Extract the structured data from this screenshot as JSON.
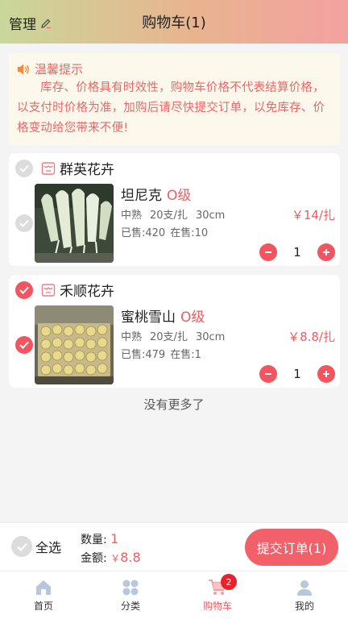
{
  "header": {
    "manage_label": "管理",
    "title": "购物车(1)"
  },
  "notice": {
    "title": "温馨提示",
    "text": "库存、价格具有时效性，购物车价格不代表结算价格，以支付时价格为准，加购后请尽快提交订单，以免库存、价格变动给您带来不便!"
  },
  "cart": [
    {
      "shop": "群英花卉",
      "shop_checked": false,
      "item": {
        "name": "坦尼克",
        "grade": "O级",
        "maturity": "中熟",
        "pack": "20支/扎",
        "length": "30cm",
        "sold": "已售:420",
        "on_sale": "在售:10",
        "price": "￥14/扎",
        "qty": "1",
        "checked": false
      }
    },
    {
      "shop": "禾顺花卉",
      "shop_checked": true,
      "item": {
        "name": "蜜桃雪山",
        "grade": "O级",
        "maturity": "中熟",
        "pack": "20支/扎",
        "length": "30cm",
        "sold": "已售:479",
        "on_sale": "在售:1",
        "price": "￥8.8/扎",
        "qty": "1",
        "checked": true
      }
    }
  ],
  "no_more": "没有更多了",
  "footer": {
    "select_all": "全选",
    "qty_label": "数量:",
    "qty_value": "1",
    "amount_label": "金额:",
    "amount_currency": "￥",
    "amount_value": "8.8",
    "submit_label": "提交订单(1)"
  },
  "tabbar": {
    "items": [
      {
        "label": "首页",
        "icon": "home-icon"
      },
      {
        "label": "分类",
        "icon": "category-icon"
      },
      {
        "label": "购物车",
        "icon": "cart-icon",
        "badge": "2",
        "active": true
      },
      {
        "label": "我的",
        "icon": "profile-icon"
      }
    ]
  },
  "colors": {
    "accent": "#f2555f",
    "price": "#ec5d62",
    "notice_bg": "#fdf8ec"
  }
}
